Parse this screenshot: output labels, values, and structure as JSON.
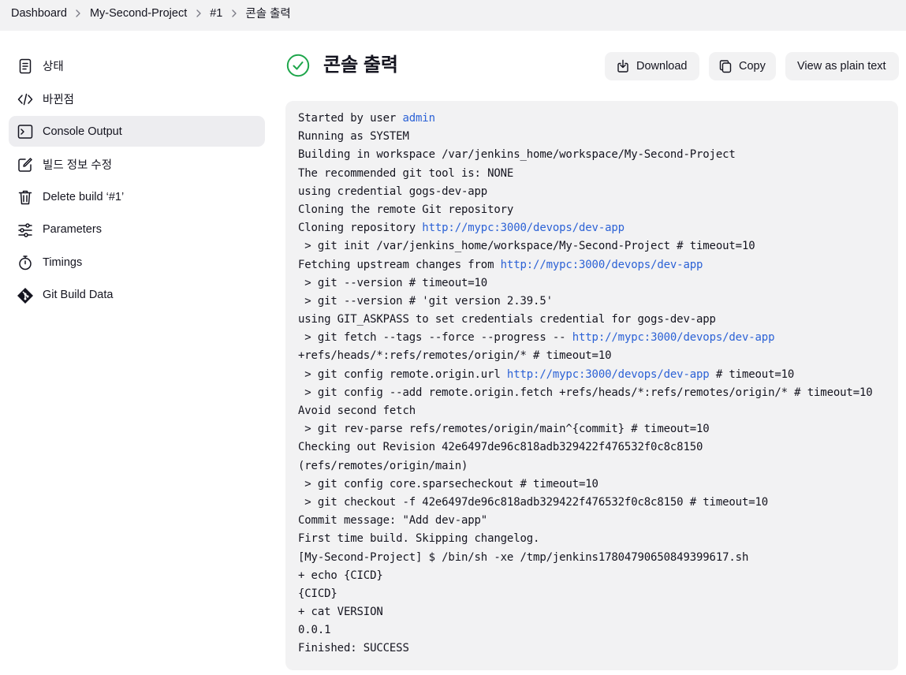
{
  "breadcrumb": {
    "items": [
      "Dashboard",
      "My-Second-Project",
      "#1",
      "콘솔 출력"
    ]
  },
  "sidebar": {
    "items": [
      {
        "label": "상태",
        "icon": "document-icon"
      },
      {
        "label": "바뀐점",
        "icon": "code-icon"
      },
      {
        "label": "Console Output",
        "icon": "terminal-icon",
        "active": true
      },
      {
        "label": "빌드 정보 수정",
        "icon": "edit-icon"
      },
      {
        "label": "Delete build ‘#1’",
        "icon": "trash-icon"
      },
      {
        "label": "Parameters",
        "icon": "sliders-icon"
      },
      {
        "label": "Timings",
        "icon": "stopwatch-icon"
      },
      {
        "label": "Git Build Data",
        "icon": "git-icon"
      }
    ]
  },
  "header": {
    "title": "콘솔 출력",
    "status_icon": "success-check-icon",
    "status_color": "#1ea64b"
  },
  "toolbar": {
    "download_label": "Download",
    "copy_label": "Copy",
    "plain_label": "View as plain text"
  },
  "colors": {
    "link": "#2c62d6",
    "panel": "#f2f2f3",
    "text": "#14141f"
  },
  "console": {
    "lines": [
      [
        {
          "t": "Started by user "
        },
        {
          "t": "admin",
          "link": true
        }
      ],
      [
        {
          "t": "Running as SYSTEM"
        }
      ],
      [
        {
          "t": "Building in workspace /var/jenkins_home/workspace/My-Second-Project"
        }
      ],
      [
        {
          "t": "The recommended git tool is: NONE"
        }
      ],
      [
        {
          "t": "using credential gogs-dev-app"
        }
      ],
      [
        {
          "t": "Cloning the remote Git repository"
        }
      ],
      [
        {
          "t": "Cloning repository "
        },
        {
          "t": "http://mypc:3000/devops/dev-app",
          "link": true
        }
      ],
      [
        {
          "t": " > git init /var/jenkins_home/workspace/My-Second-Project # timeout=10"
        }
      ],
      [
        {
          "t": "Fetching upstream changes from "
        },
        {
          "t": "http://mypc:3000/devops/dev-app",
          "link": true
        }
      ],
      [
        {
          "t": " > git --version # timeout=10"
        }
      ],
      [
        {
          "t": " > git --version # 'git version 2.39.5'"
        }
      ],
      [
        {
          "t": "using GIT_ASKPASS to set credentials credential for gogs-dev-app"
        }
      ],
      [
        {
          "t": " > git fetch --tags --force --progress -- "
        },
        {
          "t": "http://mypc:3000/devops/dev-app",
          "link": true
        }
      ],
      [
        {
          "t": "+refs/heads/*:refs/remotes/origin/* # timeout=10"
        }
      ],
      [
        {
          "t": " > git config remote.origin.url "
        },
        {
          "t": "http://mypc:3000/devops/dev-app",
          "link": true
        },
        {
          "t": " # timeout=10"
        }
      ],
      [
        {
          "t": " > git config --add remote.origin.fetch +refs/heads/*:refs/remotes/origin/* # timeout=10"
        }
      ],
      [
        {
          "t": "Avoid second fetch"
        }
      ],
      [
        {
          "t": " > git rev-parse refs/remotes/origin/main^{commit} # timeout=10"
        }
      ],
      [
        {
          "t": "Checking out Revision 42e6497de96c818adb329422f476532f0c8c8150"
        }
      ],
      [
        {
          "t": "(refs/remotes/origin/main)"
        }
      ],
      [
        {
          "t": " > git config core.sparsecheckout # timeout=10"
        }
      ],
      [
        {
          "t": " > git checkout -f 42e6497de96c818adb329422f476532f0c8c8150 # timeout=10"
        }
      ],
      [
        {
          "t": "Commit message: \"Add dev-app\""
        }
      ],
      [
        {
          "t": "First time build. Skipping changelog."
        }
      ],
      [
        {
          "t": "[My-Second-Project] $ /bin/sh -xe /tmp/jenkins17804790650849399617.sh"
        }
      ],
      [
        {
          "t": "+ echo {CICD}"
        }
      ],
      [
        {
          "t": "{CICD}"
        }
      ],
      [
        {
          "t": "+ cat VERSION"
        }
      ],
      [
        {
          "t": "0.0.1"
        }
      ],
      [
        {
          "t": "Finished: SUCCESS"
        }
      ]
    ]
  }
}
